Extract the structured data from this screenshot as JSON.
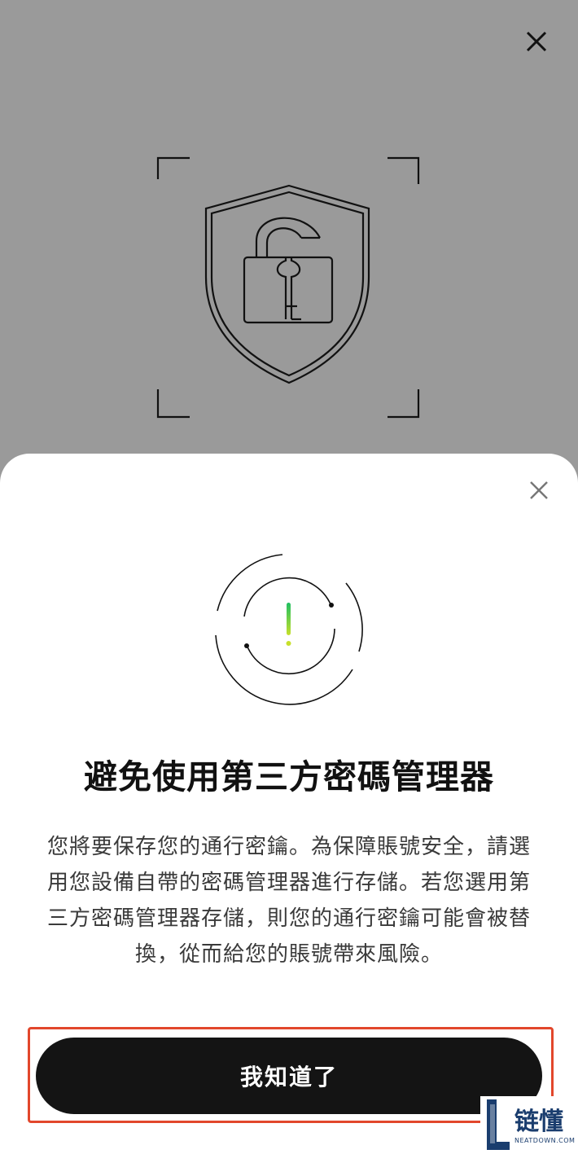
{
  "background": {
    "dim_color": "#9a9a9a",
    "close_icon": "close-icon",
    "hero_icon": "shield-unlocked-padlock-icon"
  },
  "sheet": {
    "close_icon": "close-icon",
    "alert_icon": "exclamation-icon",
    "title": "避免使用第三方密碼管理器",
    "description": "您將要保存您的通行密鑰。為保障賬號安全，請選用您設備自帶的密碼管理器進行存儲。若您選用第三方密碼管理器存儲，則您的通行密鑰可能會被替換，從而給您的賬號帶來風險。",
    "primary_button": "我知道了",
    "button_color": "#141414",
    "highlight_color": "#e2472c"
  },
  "watermark": {
    "text": "链懂",
    "subtext": "NEATDOWN.COM"
  }
}
